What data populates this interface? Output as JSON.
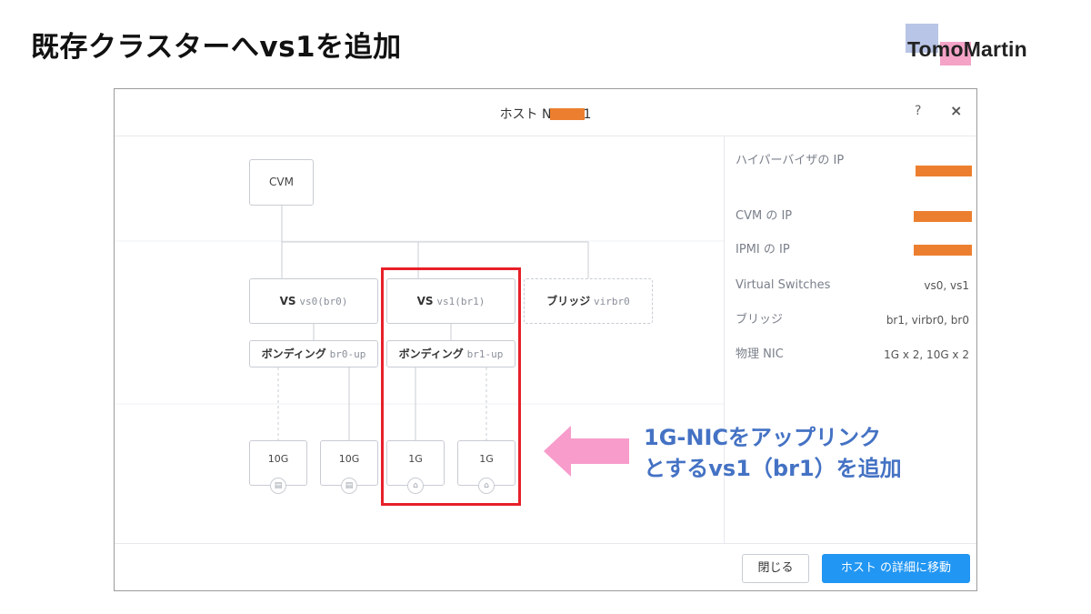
{
  "slide": {
    "title": "既存クラスターへvs1を追加"
  },
  "brand": {
    "name": "TomoMartin"
  },
  "dialog": {
    "title_prefix": "ホスト N",
    "title_suffix": "1",
    "help": "?",
    "close": "×",
    "info": [
      {
        "label": "ハイパーバイザの IP",
        "value": ""
      },
      {
        "label": "CVM の IP",
        "value": ""
      },
      {
        "label": "IPMI の IP",
        "value": ""
      },
      {
        "label": "Virtual Switches",
        "value": "vs0, vs1"
      },
      {
        "label": "ブリッジ",
        "value": "br1, virbr0, br0"
      },
      {
        "label": "物理 NIC",
        "value": "1G x 2, 10G x 2"
      }
    ],
    "buttons": {
      "close": "閉じる",
      "go_host": "ホスト の詳細に移動"
    }
  },
  "diagram": {
    "cvm": "CVM",
    "vs0": {
      "name": "VS",
      "id": "vs0(br0)"
    },
    "vs1": {
      "name": "VS",
      "id": "vs1(br1)"
    },
    "bridge": {
      "name": "ブリッジ",
      "id": "virbr0"
    },
    "bond0": {
      "name": "ボンディング",
      "id": "br0-up"
    },
    "bond1": {
      "name": "ボンディング",
      "id": "br1-up"
    },
    "nics": [
      "10G",
      "10G",
      "1G",
      "1G"
    ]
  },
  "callout": {
    "line1": "1G-NICをアップリンク",
    "line2": "とするvs1（br1）を追加"
  },
  "colors": {
    "accent": "#2196f3",
    "highlight": "#e8202a",
    "callout": "#4472c4",
    "arrow": "#f79ccb",
    "redaction": "#ec7f2f"
  }
}
